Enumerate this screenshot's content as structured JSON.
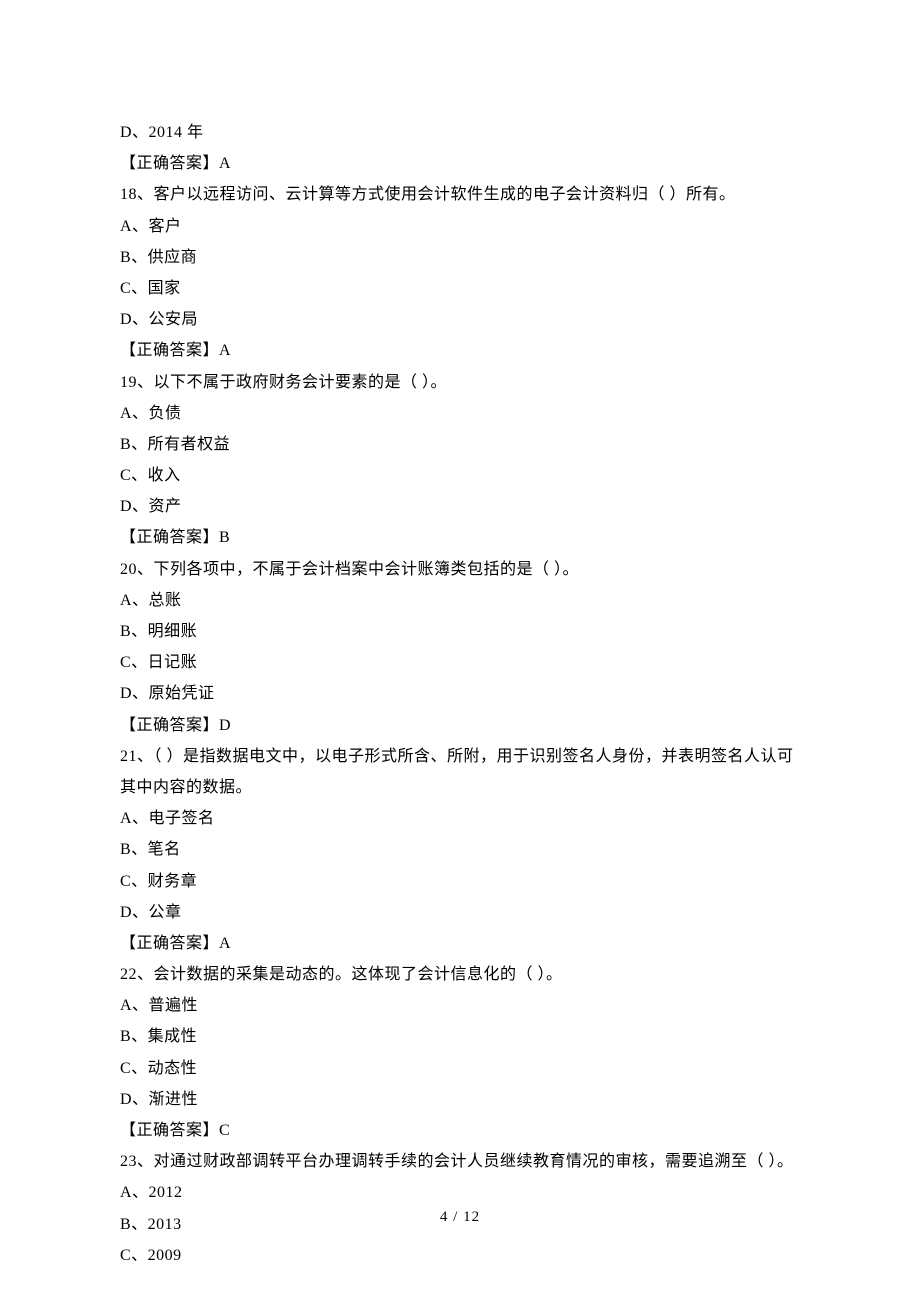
{
  "q17_continuation": {
    "option_d": "D、2014 年",
    "answer": "【正确答案】A"
  },
  "q18": {
    "stem": "18、客户以远程访问、云计算等方式使用会计软件生成的电子会计资料归（   ）所有。",
    "option_a": "A、客户",
    "option_b": "B、供应商",
    "option_c": "C、国家",
    "option_d": "D、公安局",
    "answer": "【正确答案】A"
  },
  "q19": {
    "stem": "19、以下不属于政府财务会计要素的是（ ）。",
    "option_a": "A、负债",
    "option_b": "B、所有者权益",
    "option_c": "C、收入",
    "option_d": "D、资产",
    "answer": "【正确答案】B"
  },
  "q20": {
    "stem": "20、下列各项中，不属于会计档案中会计账簿类包括的是（  ）。",
    "option_a": "A、总账",
    "option_b": "B、明细账",
    "option_c": "C、日记账",
    "option_d": "D、原始凭证",
    "answer": "【正确答案】D"
  },
  "q21": {
    "stem": "21、（  ）是指数据电文中，以电子形式所含、所附，用于识别签名人身份，并表明签名人认可其中内容的数据。",
    "option_a": "A、电子签名",
    "option_b": "B、笔名",
    "option_c": "C、财务章",
    "option_d": "D、公章",
    "answer": "【正确答案】A"
  },
  "q22": {
    "stem": "22、会计数据的采集是动态的。这体现了会计信息化的（   ）。",
    "option_a": "A、普遍性",
    "option_b": "B、集成性",
    "option_c": "C、动态性",
    "option_d": "D、渐进性",
    "answer": "【正确答案】C"
  },
  "q23": {
    "stem": "23、对通过财政部调转平台办理调转手续的会计人员继续教育情况的审核，需要追溯至（  ）。",
    "option_a": "A、2012",
    "option_b": "B、2013",
    "option_c": "C、2009"
  },
  "page_number": "4 / 12"
}
